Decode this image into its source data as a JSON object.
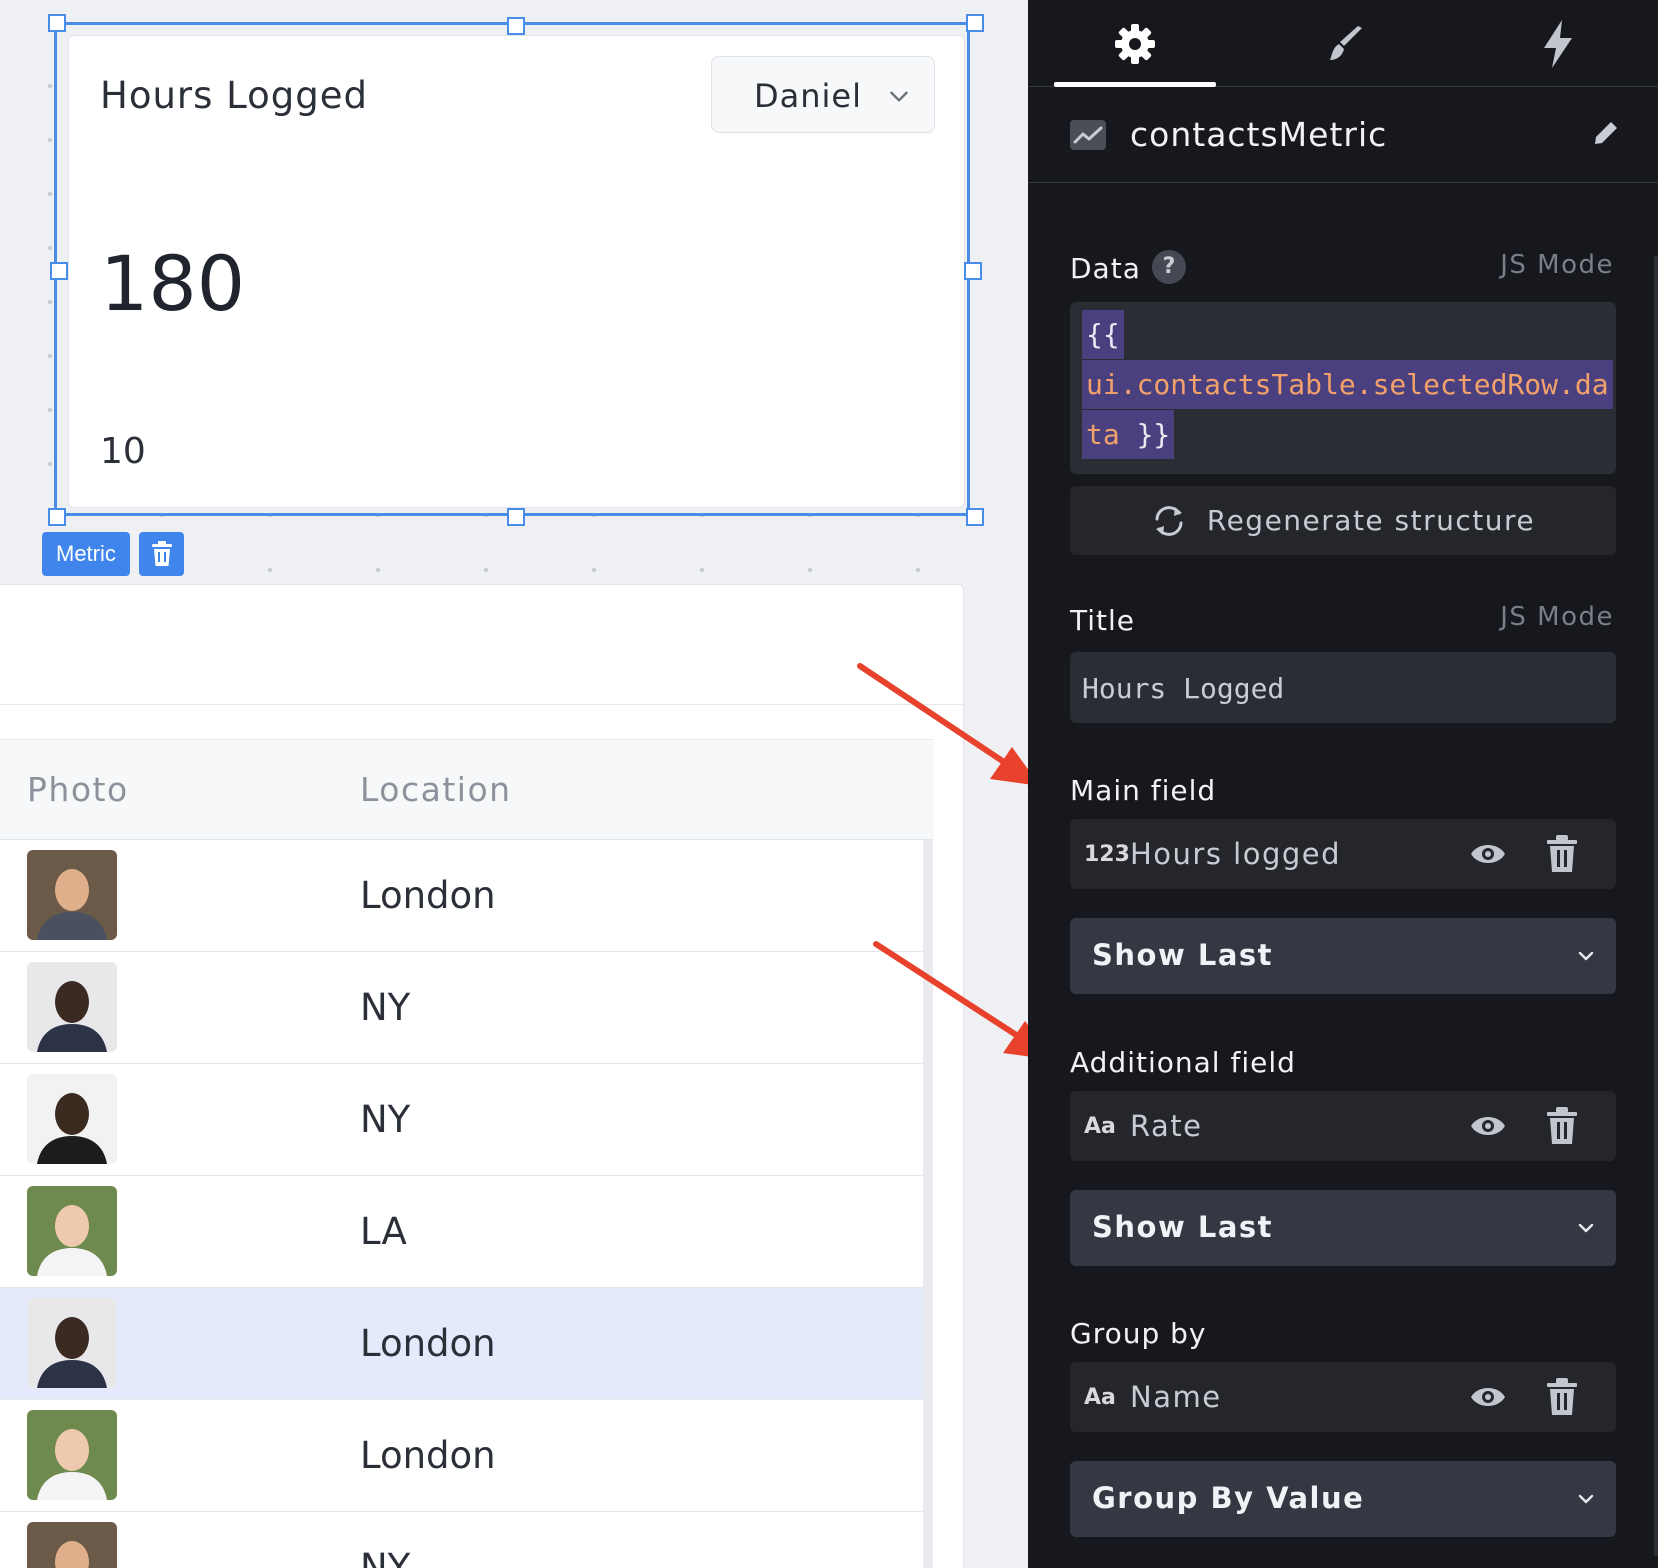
{
  "metric_widget": {
    "title": "Hours Logged",
    "select_value": "Daniel",
    "main_value": "180",
    "additional_value": "10",
    "type_tag": "Metric"
  },
  "table": {
    "columns": [
      "Photo",
      "Location"
    ],
    "rows": [
      {
        "location": "London",
        "selected": false
      },
      {
        "location": "NY",
        "selected": false
      },
      {
        "location": "NY",
        "selected": false
      },
      {
        "location": "LA",
        "selected": false
      },
      {
        "location": "London",
        "selected": true
      },
      {
        "location": "London",
        "selected": false
      },
      {
        "location": "NY",
        "selected": false
      }
    ]
  },
  "panel": {
    "widget_name": "contactsMetric",
    "data": {
      "label": "Data",
      "help_icon": "?",
      "js_mode": "JS Mode",
      "code_open": "{{",
      "code_line1": "ui.contactsTable.selectedRow.da",
      "code_line2_part": "ta",
      "code_close": "}}"
    },
    "regenerate_label": "Regenerate structure",
    "title": {
      "label": "Title",
      "js_mode": "JS Mode",
      "value": "Hours Logged"
    },
    "main_field": {
      "label": "Main field",
      "type_icon": "123",
      "name": "Hours logged",
      "dropdown": "Show Last"
    },
    "additional_field": {
      "label": "Additional field",
      "type_icon": "Aa",
      "name": "Rate",
      "dropdown": "Show Last"
    },
    "group_by": {
      "label": "Group by",
      "type_icon": "Aa",
      "name": "Name",
      "dropdown": "Group By Value"
    }
  },
  "colors": {
    "selection": "#4a8de8",
    "panel_bg": "#16181d",
    "arrow": "#e8412c",
    "selected_row": "#e4e9fb"
  },
  "icons": [
    "gear-icon",
    "brush-icon",
    "lightning-icon",
    "chart-icon",
    "pencil-icon",
    "help-icon",
    "refresh-icon",
    "eye-icon",
    "trash-icon",
    "chevron-down-icon"
  ]
}
